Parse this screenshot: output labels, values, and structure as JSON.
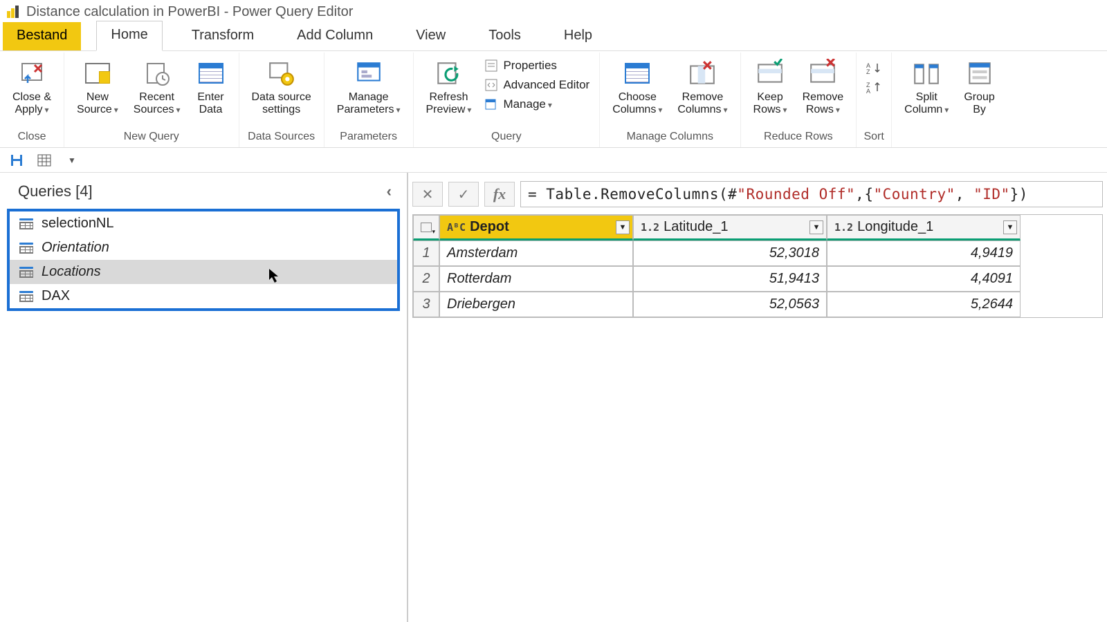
{
  "title": "Distance calculation in PowerBI - Power Query Editor",
  "menu": {
    "file": "Bestand",
    "tabs": [
      "Home",
      "Transform",
      "Add Column",
      "View",
      "Tools",
      "Help"
    ],
    "activeTab": "Home"
  },
  "ribbon": {
    "close": {
      "close_apply": "Close &\nApply",
      "group": "Close"
    },
    "newquery": {
      "new_source": "New\nSource",
      "recent_sources": "Recent\nSources",
      "enter_data": "Enter\nData",
      "group": "New Query"
    },
    "datasources": {
      "settings": "Data source\nsettings",
      "group": "Data Sources"
    },
    "params": {
      "manage": "Manage\nParameters",
      "group": "Parameters"
    },
    "query": {
      "refresh": "Refresh\nPreview",
      "properties": "Properties",
      "advanced": "Advanced Editor",
      "manage": "Manage",
      "group": "Query"
    },
    "columns": {
      "choose": "Choose\nColumns",
      "remove": "Remove\nColumns",
      "group": "Manage Columns"
    },
    "rows": {
      "keep": "Keep\nRows",
      "remove": "Remove\nRows",
      "group": "Reduce Rows"
    },
    "sort": {
      "group": "Sort"
    },
    "split": {
      "split": "Split\nColumn",
      "group_by": "Group\nBy"
    }
  },
  "side": {
    "header": "Queries [4]",
    "queries": [
      {
        "name": "selectionNL",
        "italic": false,
        "selected": false
      },
      {
        "name": "Orientation",
        "italic": true,
        "selected": false
      },
      {
        "name": "Locations",
        "italic": true,
        "selected": true
      },
      {
        "name": "DAX",
        "italic": false,
        "selected": false
      }
    ]
  },
  "formula": {
    "pre": "= Table.RemoveColumns(#",
    "str1": "\"Rounded Off\"",
    "mid": ",{",
    "str2": "\"Country\"",
    "sep": ", ",
    "str3": "\"ID\"",
    "post": "})"
  },
  "table": {
    "columns": [
      {
        "name": "Depot",
        "type": "AᴮC",
        "selected": true
      },
      {
        "name": "Latitude_1",
        "type": "1.2",
        "selected": false
      },
      {
        "name": "Longitude_1",
        "type": "1.2",
        "selected": false
      }
    ],
    "rows": [
      {
        "n": "1",
        "depot": "Amsterdam",
        "lat": "52,3018",
        "lon": "4,9419"
      },
      {
        "n": "2",
        "depot": "Rotterdam",
        "lat": "51,9413",
        "lon": "4,4091"
      },
      {
        "n": "3",
        "depot": "Driebergen",
        "lat": "52,0563",
        "lon": "5,2644"
      }
    ]
  }
}
